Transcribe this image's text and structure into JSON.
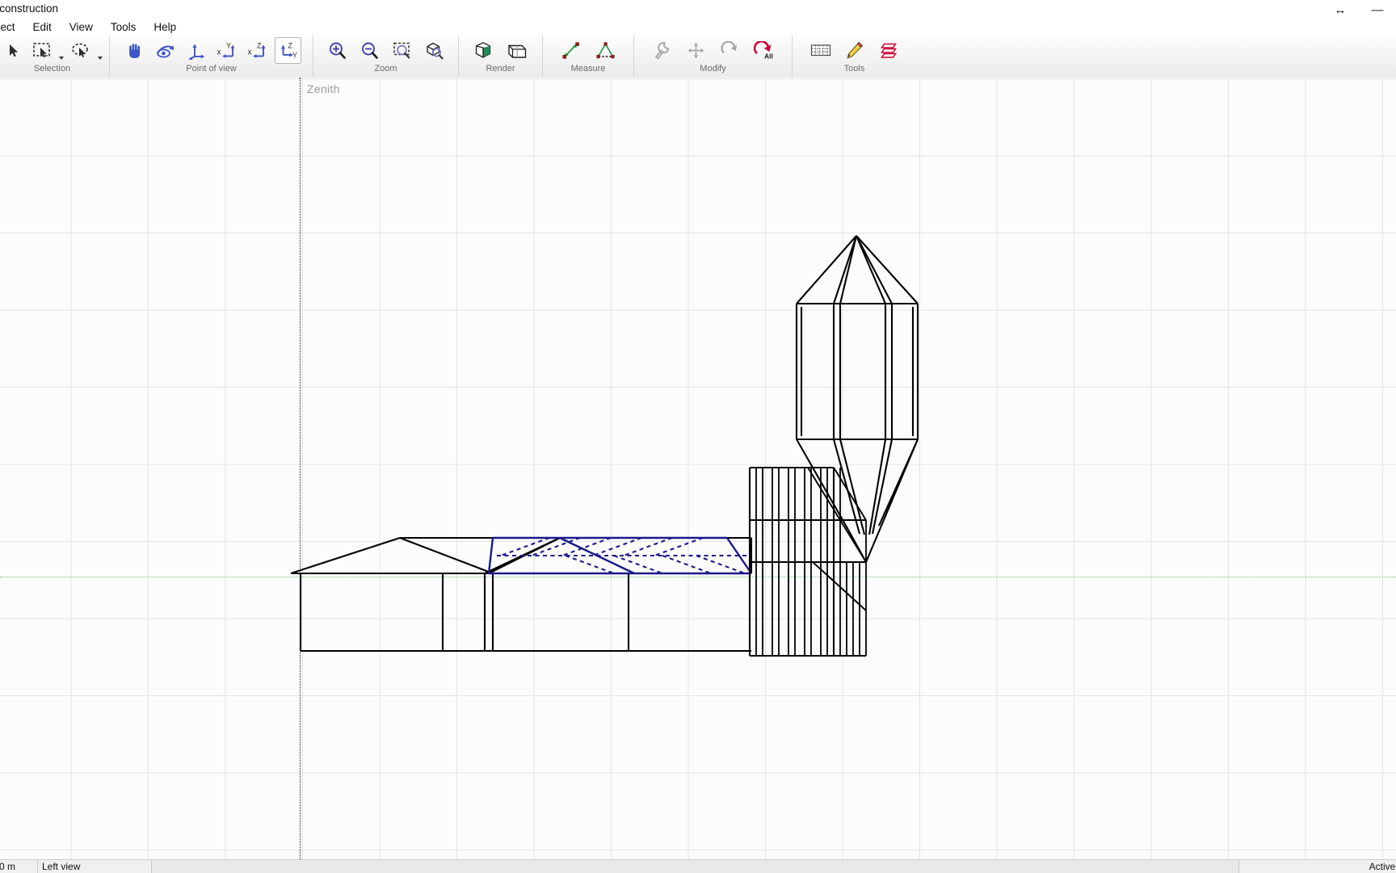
{
  "window": {
    "title": "e construction",
    "controls": [
      {
        "name": "resize-window-button",
        "glyph": "↔"
      },
      {
        "name": "minimize-window-button",
        "glyph": "—"
      }
    ]
  },
  "menubar": {
    "items": [
      {
        "label": "elect",
        "name": "menu-select"
      },
      {
        "label": "Edit",
        "name": "menu-edit"
      },
      {
        "label": "View",
        "name": "menu-view"
      },
      {
        "label": "Tools",
        "name": "menu-tools"
      },
      {
        "label": "Help",
        "name": "menu-help"
      }
    ]
  },
  "ribbon": {
    "groups": [
      {
        "label": "Selection",
        "name": "ribbon-group-selection",
        "buttons": [
          {
            "name": "pointer-arrow-icon",
            "icon": "pointer",
            "selected": false,
            "dropdown": false,
            "enabled": true
          },
          {
            "name": "rectangle-select-icon",
            "icon": "rect-select",
            "selected": false,
            "dropdown": true,
            "enabled": true
          },
          {
            "name": "lasso-select-icon",
            "icon": "lasso-select",
            "selected": false,
            "dropdown": true,
            "enabled": true
          }
        ]
      },
      {
        "label": "Point of view",
        "name": "ribbon-group-point-of-view",
        "buttons": [
          {
            "name": "pan-hand-icon",
            "icon": "hand",
            "selected": false,
            "dropdown": false,
            "enabled": true
          },
          {
            "name": "orbit-eye-icon",
            "icon": "orbit-eye",
            "selected": false,
            "dropdown": false,
            "enabled": true
          },
          {
            "name": "axonometric-axes-icon",
            "icon": "axes3d",
            "selected": false,
            "dropdown": false,
            "enabled": true
          },
          {
            "name": "view-xy-icon",
            "icon": "xy",
            "selected": false,
            "dropdown": false,
            "enabled": true
          },
          {
            "name": "view-xz-icon",
            "icon": "xz",
            "selected": false,
            "dropdown": false,
            "enabled": true
          },
          {
            "name": "view-zy-icon",
            "icon": "zy",
            "selected": true,
            "dropdown": false,
            "enabled": true
          }
        ]
      },
      {
        "label": "Zoom",
        "name": "ribbon-group-zoom",
        "buttons": [
          {
            "name": "zoom-in-icon",
            "icon": "zoom-in",
            "selected": false,
            "dropdown": false,
            "enabled": true
          },
          {
            "name": "zoom-out-icon",
            "icon": "zoom-out",
            "selected": false,
            "dropdown": false,
            "enabled": true
          },
          {
            "name": "zoom-window-icon",
            "icon": "zoom-window",
            "selected": false,
            "dropdown": false,
            "enabled": true
          },
          {
            "name": "zoom-all-icon",
            "icon": "zoom-all",
            "selected": false,
            "dropdown": false,
            "enabled": true
          }
        ]
      },
      {
        "label": "Render",
        "name": "ribbon-group-render",
        "buttons": [
          {
            "name": "shaded-cube-icon",
            "icon": "shaded-cube",
            "selected": false,
            "dropdown": false,
            "enabled": true
          },
          {
            "name": "wireframe-box-icon",
            "icon": "wire-box",
            "selected": false,
            "dropdown": false,
            "enabled": true
          }
        ]
      },
      {
        "label": "Measure",
        "name": "ribbon-group-measure",
        "buttons": [
          {
            "name": "measure-distance-icon",
            "icon": "measure-dist",
            "selected": false,
            "dropdown": false,
            "enabled": true
          },
          {
            "name": "measure-angle-icon",
            "icon": "measure-angle",
            "selected": false,
            "dropdown": false,
            "enabled": true
          }
        ]
      },
      {
        "label": "Modify",
        "name": "ribbon-group-modify",
        "buttons": [
          {
            "name": "wrench-icon",
            "icon": "wrench",
            "selected": false,
            "dropdown": false,
            "enabled": false
          },
          {
            "name": "move-icon",
            "icon": "move",
            "selected": false,
            "dropdown": false,
            "enabled": false
          },
          {
            "name": "rotate-icon",
            "icon": "rotate",
            "selected": false,
            "dropdown": false,
            "enabled": false
          },
          {
            "name": "rotate-all-icon",
            "icon": "rotate-all",
            "selected": false,
            "dropdown": false,
            "enabled": true,
            "badge": "All"
          }
        ]
      },
      {
        "label": "Tools",
        "name": "ribbon-group-tools",
        "buttons": [
          {
            "name": "grid-icon",
            "icon": "grid",
            "selected": false,
            "dropdown": false,
            "enabled": true
          },
          {
            "name": "pencil-icon",
            "icon": "pencil",
            "selected": false,
            "dropdown": false,
            "enabled": true
          },
          {
            "name": "layers-icon",
            "icon": "layers",
            "selected": false,
            "dropdown": false,
            "enabled": true
          }
        ]
      }
    ]
  },
  "viewport": {
    "zenith_label": "Zenith",
    "grid_spacing_px": 95,
    "colors": {
      "background": "#fcfcfc",
      "grid": "#e4e4e4",
      "zenith_axis": "#151515",
      "ground_line": "#7fbf7f",
      "wireframe": "#000000",
      "selection": "#1a1a8c"
    }
  },
  "statusbar": {
    "coordinate": "0 m",
    "view_name": "Left view",
    "right_message": "Active are"
  }
}
